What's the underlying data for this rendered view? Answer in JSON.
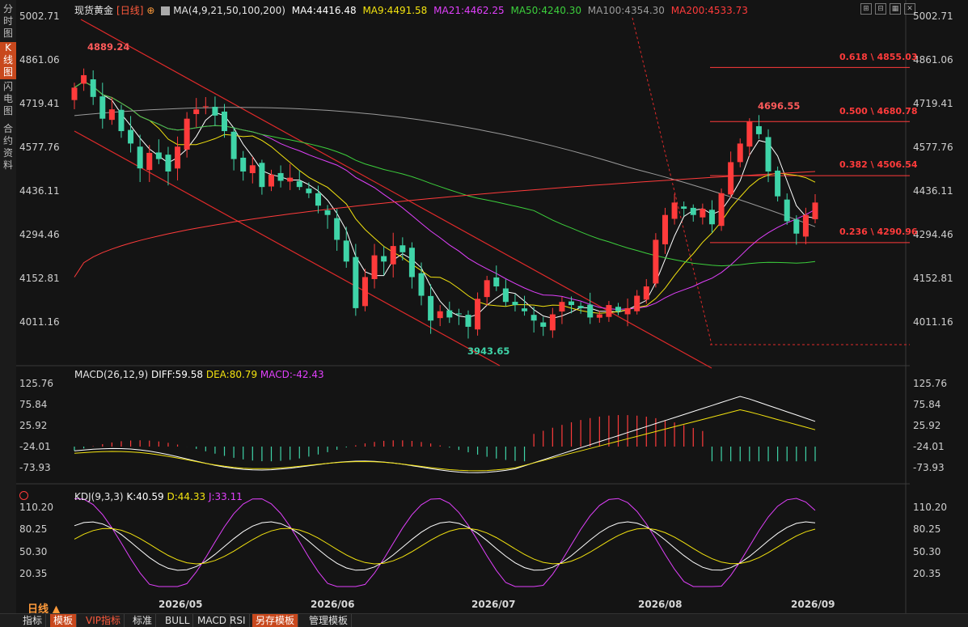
{
  "left_tabs": [
    "分时图",
    "K线图",
    "闪电图",
    "合约资料"
  ],
  "legend": {
    "title": "现货黄金",
    "period": "[日线]",
    "ma_label": "MA(4,9,21,50,100,200)",
    "ma4": "MA4:4416.48",
    "ma9": "MA9:4491.58",
    "ma21": "MA21:4462.25",
    "ma50": "MA50:4240.30",
    "ma100": "MA100:4354.30",
    "ma200": "MA200:4533.73"
  },
  "colors": {
    "up": "#ff3b3b",
    "down": "#3fd4a8",
    "ma4": "#ffffff",
    "ma9": "#f2e20f",
    "ma21": "#e040fb",
    "ma50": "#3ccf3c",
    "ma100": "#9a9a9a",
    "ma200": "#ff3b3b",
    "accent": "#c8481d"
  },
  "price_axis": [
    "5002.71",
    "4861.06",
    "4719.41",
    "4577.76",
    "4436.11",
    "4294.46",
    "4152.81",
    "4011.16"
  ],
  "annotations": {
    "high_left": "4889.24",
    "low": "3943.65",
    "high_right": "4696.55"
  },
  "fib_levels": [
    {
      "label": "0.618 \\ 4855.03",
      "value": 4855.03
    },
    {
      "label": "0.500 \\ 4680.78",
      "value": 4680.78
    },
    {
      "label": "0.382 \\ 4506.54",
      "value": 4506.54
    },
    {
      "label": "0.236 \\ 4290.96",
      "value": 4290.96
    }
  ],
  "macd": {
    "label": "MACD(26,12,9)",
    "diff": "DIFF:59.58",
    "dea": "DEA:80.79",
    "macd": "MACD:-42.43",
    "axis": [
      "125.76",
      "75.84",
      "25.92",
      "-24.01",
      "-73.93"
    ]
  },
  "kdj": {
    "label": "KDJ(9,3,3)",
    "k": "K:40.59",
    "d": "D:44.33",
    "j": "J:33.11",
    "axis": [
      "110.20",
      "80.25",
      "50.30",
      "20.35"
    ]
  },
  "x_axis": [
    "2026/05",
    "2026/06",
    "2026/07",
    "2026/08",
    "2026/09"
  ],
  "period_selector": "日线 ▲",
  "bottom_bar": [
    "指标",
    "模板",
    "VIP指标",
    "标准",
    "BULL",
    "MACD",
    "RSI",
    "另存模板",
    "管理模板"
  ],
  "chart_data": {
    "type": "candlestick",
    "title": "现货黄金 [日线]",
    "ylim": [
      3943.65,
      5002.71
    ],
    "closes": [
      4790,
      4830,
      4760,
      4690,
      4720,
      4650,
      4610,
      4530,
      4580,
      4560,
      4520,
      4600,
      4690,
      4720,
      4730,
      4700,
      4650,
      4560,
      4520,
      4540,
      4470,
      4510,
      4490,
      4500,
      4470,
      4450,
      4410,
      4380,
      4300,
      4230,
      4080,
      4180,
      4250,
      4230,
      4280,
      4260,
      4180,
      4120,
      4040,
      4070,
      4050,
      4060,
      4020,
      4110,
      4170,
      4150,
      4100,
      4090,
      4070,
      4040,
      4020,
      4060,
      4100,
      4090,
      4080,
      4050,
      4060,
      4090,
      4070,
      4080,
      4120,
      4150,
      4300,
      4380,
      4420,
      4400,
      4380,
      4400,
      4350,
      4450,
      4550,
      4610,
      4680,
      4640,
      4520,
      4440,
      4360,
      4320,
      4380,
      4420
    ]
  }
}
